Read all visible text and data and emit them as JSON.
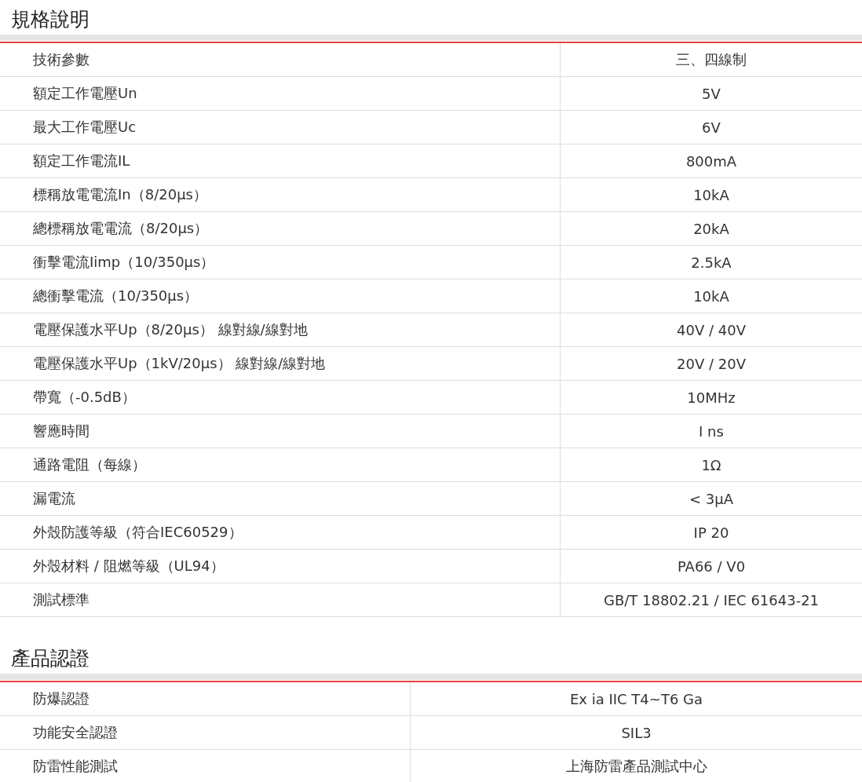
{
  "sections": [
    {
      "title": "規格說明",
      "rows": [
        {
          "label": "技術參數",
          "value": "三、四線制"
        },
        {
          "label": "額定工作電壓Un",
          "value": "5V"
        },
        {
          "label": "最大工作電壓Uc",
          "value": "6V"
        },
        {
          "label": "額定工作電流IL",
          "value": "800mA"
        },
        {
          "label": "標稱放電電流In（8/20μs）",
          "value": "10kA"
        },
        {
          "label": "總標稱放電電流（8/20μs）",
          "value": "20kA"
        },
        {
          "label": "衝擊電流Iimp（10/350μs）",
          "value": "2.5kA"
        },
        {
          "label": "總衝擊電流（10/350μs）",
          "value": "10kA"
        },
        {
          "label": "電壓保護水平Up（8/20μs） 線對線/線對地",
          "value": "40V / 40V"
        },
        {
          "label": "電壓保護水平Up（1kV/20μs） 線對線/線對地",
          "value": "20V / 20V"
        },
        {
          "label": "帶寬（-0.5dB）",
          "value": "10MHz"
        },
        {
          "label": "響應時間",
          "value": "I ns"
        },
        {
          "label": "通路電阻（每線）",
          "value": "1Ω"
        },
        {
          "label": "漏電流",
          "value": "< 3μA"
        },
        {
          "label": "外殼防護等級（符合IEC60529）",
          "value": "IP 20"
        },
        {
          "label": "外殼材料 / 阻燃等級（UL94）",
          "value": "PA66 / V0"
        },
        {
          "label": "測試標準",
          "value": "GB/T 18802.21 / IEC 61643-21"
        }
      ]
    },
    {
      "title": "產品認證",
      "rows": [
        {
          "label": "防爆認證",
          "value": "Ex ia IIC T4~T6 Ga"
        },
        {
          "label": "功能安全認證",
          "value": "SIL3"
        },
        {
          "label": "防雷性能測試",
          "value": "上海防雷產品測試中心"
        }
      ]
    }
  ]
}
